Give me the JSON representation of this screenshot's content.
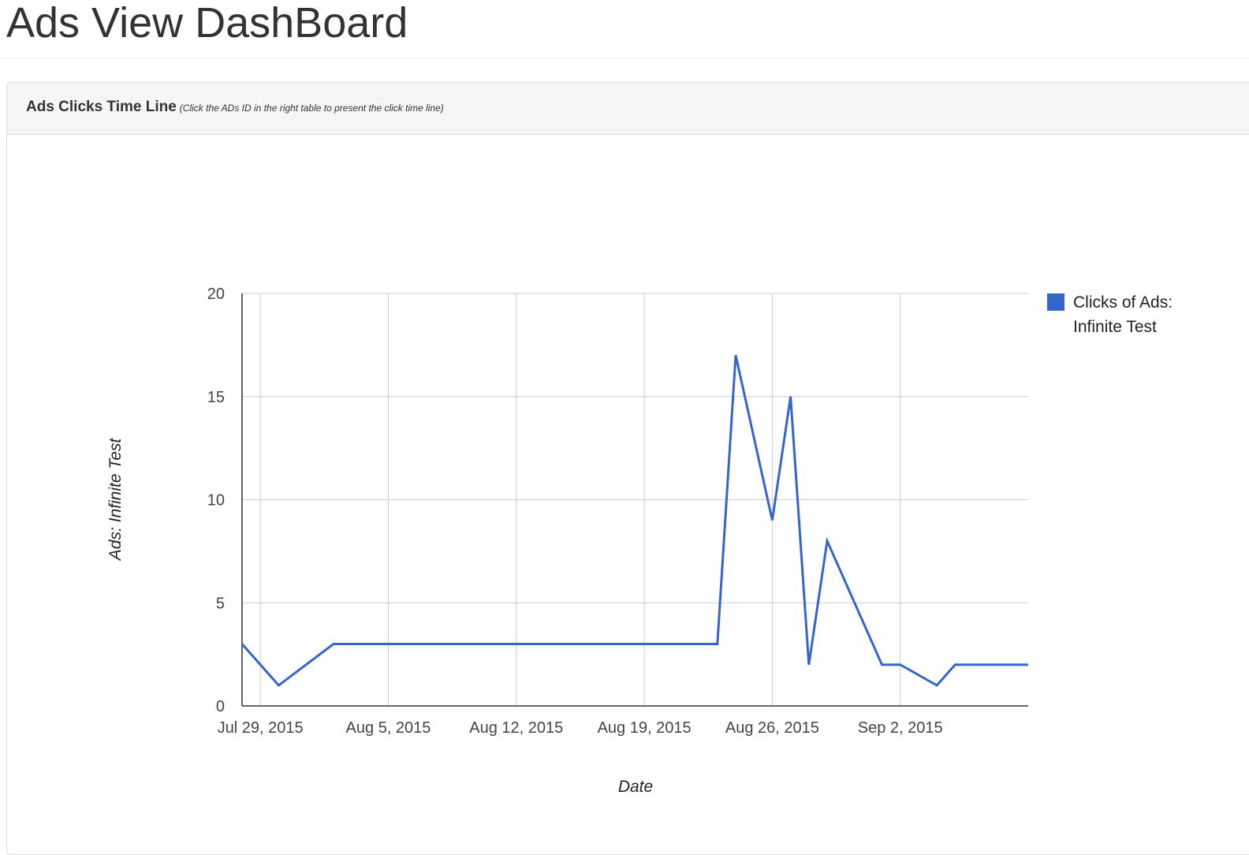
{
  "page": {
    "title": "Ads View DashBoard"
  },
  "panel": {
    "title": "Ads Clicks Time Line",
    "hint": "(Click the ADs ID in the right table to present the click time line)"
  },
  "colors": {
    "series": "#3366cc",
    "grid": "#cccccc",
    "axis": "#333333",
    "panel_heading_bg": "#f5f5f5"
  },
  "chart_data": {
    "type": "line",
    "title": "",
    "xlabel": "Date",
    "ylabel": "Ads: Infinite Test",
    "ylim": [
      0,
      20
    ],
    "yticks": [
      0,
      5,
      10,
      15,
      20
    ],
    "xlim": [
      "2015-07-28",
      "2015-09-09"
    ],
    "xticks": [
      {
        "date": "2015-07-29",
        "label": "Jul 29, 2015"
      },
      {
        "date": "2015-08-05",
        "label": "Aug 5, 2015"
      },
      {
        "date": "2015-08-12",
        "label": "Aug 12, 2015"
      },
      {
        "date": "2015-08-19",
        "label": "Aug 19, 2015"
      },
      {
        "date": "2015-08-26",
        "label": "Aug 26, 2015"
      },
      {
        "date": "2015-09-02",
        "label": "Sep 2, 2015"
      }
    ],
    "grid": true,
    "legend_position": "right",
    "series": [
      {
        "name": "Clicks of Ads: Infinite Test",
        "legend_lines": [
          "Clicks of Ads:",
          "Infinite Test"
        ],
        "points": [
          {
            "x": "2015-07-28",
            "y": 3
          },
          {
            "x": "2015-07-30",
            "y": 1
          },
          {
            "x": "2015-08-02",
            "y": 3
          },
          {
            "x": "2015-08-23",
            "y": 3
          },
          {
            "x": "2015-08-24",
            "y": 17
          },
          {
            "x": "2015-08-26",
            "y": 9
          },
          {
            "x": "2015-08-27",
            "y": 15
          },
          {
            "x": "2015-08-28",
            "y": 2
          },
          {
            "x": "2015-08-29",
            "y": 8
          },
          {
            "x": "2015-09-01",
            "y": 2
          },
          {
            "x": "2015-09-02",
            "y": 2
          },
          {
            "x": "2015-09-04",
            "y": 1
          },
          {
            "x": "2015-09-05",
            "y": 2
          },
          {
            "x": "2015-09-09",
            "y": 2
          }
        ]
      }
    ]
  }
}
